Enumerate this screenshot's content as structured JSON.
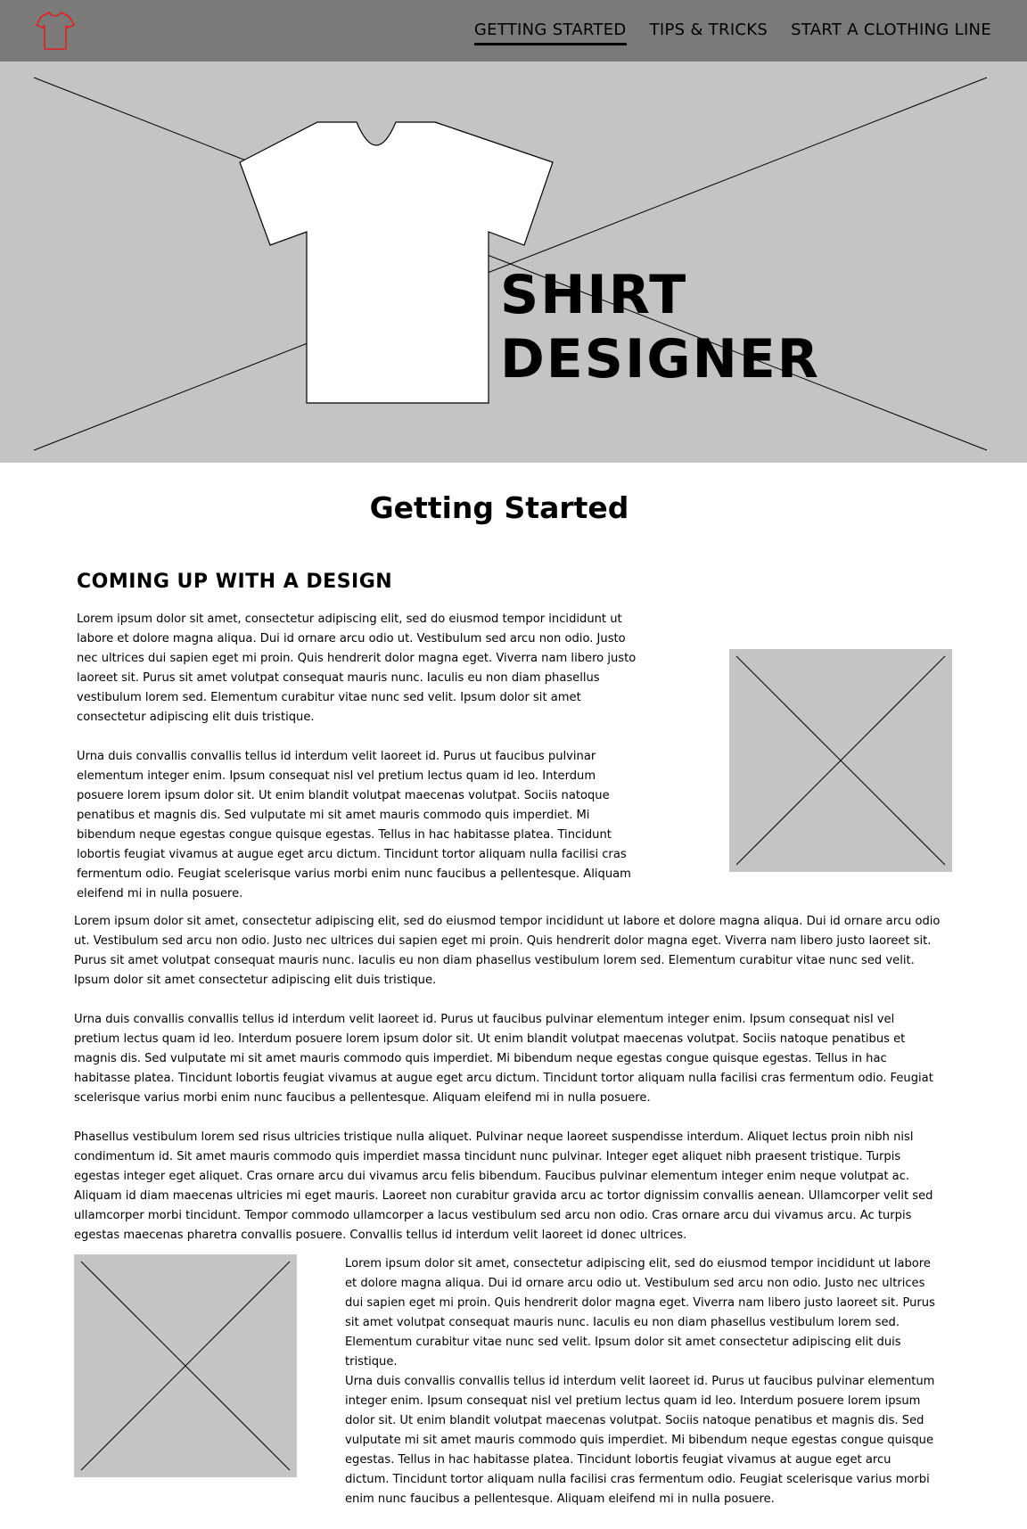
{
  "header": {
    "logo_icon": "tshirt-outline-icon",
    "logo_color": "#e02020",
    "background": "#7c7a79",
    "nav": [
      {
        "label": "GETTING STARTED",
        "active": true
      },
      {
        "label": "TIPS & TRICKS",
        "active": false
      },
      {
        "label": "START A CLOTHING LINE",
        "active": false
      }
    ]
  },
  "hero": {
    "background": "#c4c4c4",
    "title_line1": "SHIRT",
    "title_line2": "DESIGNER",
    "shirt_icon": "tshirt-icon"
  },
  "main": {
    "page_title": "Getting Started",
    "section_title": "COMING UP WITH A DESIGN",
    "paragraphs": {
      "p1": "Lorem ipsum dolor sit amet, consectetur adipiscing elit, sed do eiusmod tempor incididunt ut labore et dolore magna aliqua. Dui id ornare arcu odio ut. Vestibulum sed arcu non odio. Justo nec ultrices dui sapien eget mi proin. Quis hendrerit dolor magna eget. Viverra nam libero justo laoreet sit. Purus sit amet volutpat consequat mauris nunc. Iaculis eu non diam phasellus vestibulum lorem sed. Elementum curabitur vitae nunc sed velit. Ipsum dolor sit amet consectetur adipiscing elit duis tristique.",
      "p2": "Urna duis convallis convallis tellus id interdum velit laoreet id. Purus ut faucibus pulvinar elementum integer enim. Ipsum consequat nisl vel pretium lectus quam id leo. Interdum posuere lorem ipsum dolor sit. Ut enim blandit volutpat maecenas volutpat. Sociis natoque penatibus et magnis dis. Sed vulputate mi sit amet mauris commodo quis imperdiet. Mi bibendum neque egestas congue quisque egestas. Tellus in hac habitasse platea. Tincidunt lobortis feugiat vivamus at augue eget arcu dictum. Tincidunt tortor aliquam nulla facilisi cras fermentum odio. Feugiat scelerisque varius morbi enim nunc faucibus a pellentesque. Aliquam eleifend mi in nulla posuere.",
      "p3": "Lorem ipsum dolor sit amet, consectetur adipiscing elit, sed do eiusmod tempor incididunt ut labore et dolore magna aliqua. Dui id ornare arcu odio ut. Vestibulum sed arcu non odio. Justo nec ultrices dui sapien eget mi proin. Quis hendrerit dolor magna eget. Viverra nam libero justo laoreet sit. Purus sit amet volutpat consequat mauris nunc. Iaculis eu non diam phasellus vestibulum lorem sed. Elementum curabitur vitae nunc sed velit. Ipsum dolor sit amet consectetur adipiscing elit duis tristique.",
      "p4": "Urna duis convallis convallis tellus id interdum velit laoreet id. Purus ut faucibus pulvinar elementum integer enim. Ipsum consequat nisl vel pretium lectus quam id leo. Interdum posuere lorem ipsum dolor sit. Ut enim blandit volutpat maecenas volutpat. Sociis natoque penatibus et magnis dis. Sed vulputate mi sit amet mauris commodo quis imperdiet. Mi bibendum neque egestas congue quisque egestas. Tellus in hac habitasse platea. Tincidunt lobortis feugiat vivamus at augue eget arcu dictum. Tincidunt tortor aliquam nulla facilisi cras fermentum odio. Feugiat scelerisque varius morbi enim nunc faucibus a pellentesque. Aliquam eleifend mi in nulla posuere.",
      "p5": "Phasellus vestibulum lorem sed risus ultricies tristique nulla aliquet. Pulvinar neque laoreet suspendisse interdum. Aliquet lectus proin nibh nisl condimentum id. Sit amet mauris commodo quis imperdiet massa tincidunt nunc pulvinar. Integer eget aliquet nibh praesent tristique. Turpis egestas integer eget aliquet. Cras ornare arcu dui vivamus arcu felis bibendum. Faucibus pulvinar elementum integer enim neque volutpat ac. Aliquam id diam maecenas ultricies mi eget mauris. Laoreet non curabitur gravida arcu ac tortor dignissim convallis aenean. Ullamcorper velit sed ullamcorper morbi tincidunt. Tempor commodo ullamcorper a lacus vestibulum sed arcu non odio. Cras ornare arcu dui vivamus arcu. Ac turpis egestas maecenas pharetra convallis posuere. Convallis tellus id interdum velit laoreet id donec ultrices.",
      "p6": "Lorem ipsum dolor sit amet, consectetur adipiscing elit, sed do eiusmod tempor incididunt ut labore et dolore magna aliqua. Dui id ornare arcu odio ut. Vestibulum sed arcu non odio. Justo nec ultrices dui sapien eget mi proin. Quis hendrerit dolor magna eget. Viverra nam libero justo laoreet sit. Purus sit amet volutpat consequat mauris nunc. Iaculis eu non diam phasellus vestibulum lorem sed. Elementum curabitur vitae nunc sed velit. Ipsum dolor sit amet consectetur adipiscing elit duis tristique.",
      "p7": "Urna duis convallis convallis tellus id interdum velit laoreet id. Purus ut faucibus pulvinar elementum integer enim. Ipsum consequat nisl vel pretium lectus quam id leo. Interdum posuere lorem ipsum dolor sit. Ut enim blandit volutpat maecenas volutpat. Sociis natoque penatibus et magnis dis. Sed vulputate mi sit amet mauris commodo quis imperdiet. Mi bibendum neque egestas congue quisque egestas. Tellus in hac habitasse platea. Tincidunt lobortis feugiat vivamus at augue eget arcu dictum. Tincidunt tortor aliquam nulla facilisi cras fermentum odio. Feugiat scelerisque varius morbi enim nunc faucibus a pellentesque. Aliquam eleifend mi in nulla posuere."
    },
    "placeholder_color": "#c4c4c4"
  }
}
